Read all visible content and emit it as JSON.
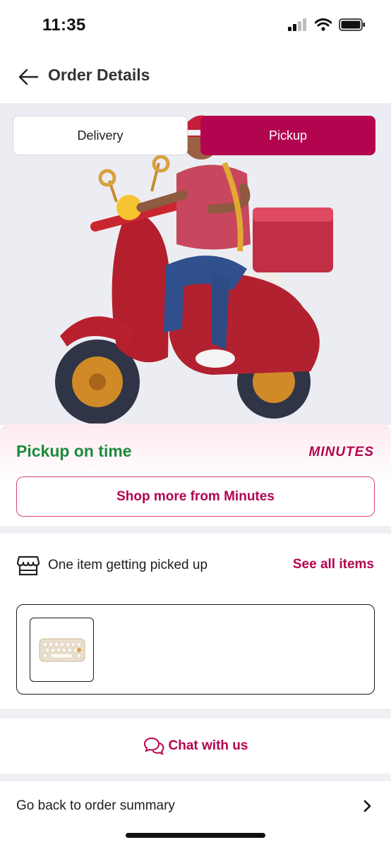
{
  "status_bar": {
    "time": "11:35"
  },
  "header": {
    "title": "Order Details"
  },
  "mode_toggle": {
    "delivery_label": "Delivery",
    "pickup_label": "Pickup",
    "selected": "Pickup"
  },
  "order_status": {
    "text": "Pickup on time",
    "brand": "MINUTES",
    "shop_more_label": "Shop more from Minutes"
  },
  "items": {
    "title": "One item getting picked up",
    "see_all_label": "See all items",
    "count": 1
  },
  "chat": {
    "label": "Chat with us"
  },
  "summary": {
    "label": "Go back to order summary"
  },
  "colors": {
    "accent": "#b3054f",
    "success": "#1d8a3c",
    "hero_background": "#ecedf2"
  },
  "icons": [
    "back-arrow-icon",
    "store-icon",
    "chat-bubbles-icon",
    "chevron-right-icon",
    "signal-icon",
    "wifi-icon",
    "battery-icon"
  ]
}
